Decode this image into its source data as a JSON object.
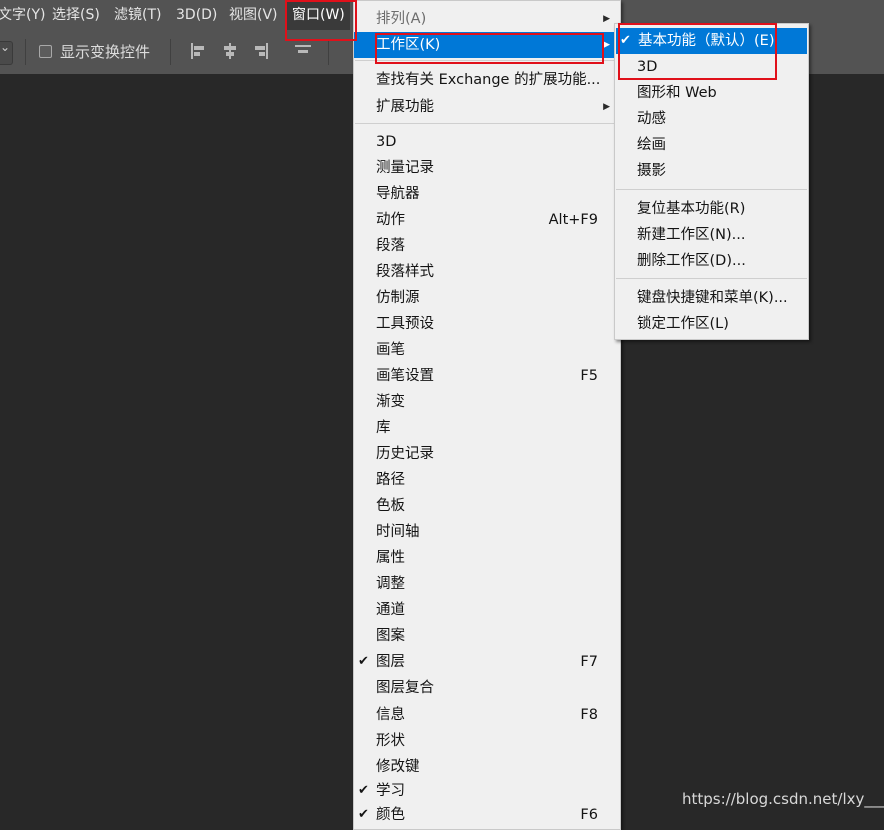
{
  "menubar": {
    "items": [
      {
        "label": "文字(Y)"
      },
      {
        "label": "选择(S)"
      },
      {
        "label": "滤镜(T)"
      },
      {
        "label": "3D(D)"
      },
      {
        "label": "视图(V)"
      },
      {
        "label": "窗口(W)"
      }
    ]
  },
  "options_bar": {
    "show_transform_label": "显示变换控件"
  },
  "window_menu": {
    "items": [
      {
        "label": "排列(A)",
        "shortcut": "",
        "submenu": true,
        "checked": false
      },
      {
        "label": "工作区(K)",
        "shortcut": "",
        "submenu": true,
        "checked": false
      },
      {
        "label": "查找有关 Exchange 的扩展功能...",
        "shortcut": "",
        "submenu": false,
        "checked": false
      },
      {
        "label": "扩展功能",
        "shortcut": "",
        "submenu": true,
        "checked": false
      },
      {
        "label": "3D",
        "shortcut": "",
        "submenu": false,
        "checked": false
      },
      {
        "label": "测量记录",
        "shortcut": "",
        "submenu": false,
        "checked": false
      },
      {
        "label": "导航器",
        "shortcut": "",
        "submenu": false,
        "checked": false
      },
      {
        "label": "动作",
        "shortcut": "Alt+F9",
        "submenu": false,
        "checked": false
      },
      {
        "label": "段落",
        "shortcut": "",
        "submenu": false,
        "checked": false
      },
      {
        "label": "段落样式",
        "shortcut": "",
        "submenu": false,
        "checked": false
      },
      {
        "label": "仿制源",
        "shortcut": "",
        "submenu": false,
        "checked": false
      },
      {
        "label": "工具预设",
        "shortcut": "",
        "submenu": false,
        "checked": false
      },
      {
        "label": "画笔",
        "shortcut": "",
        "submenu": false,
        "checked": false
      },
      {
        "label": "画笔设置",
        "shortcut": "F5",
        "submenu": false,
        "checked": false
      },
      {
        "label": "渐变",
        "shortcut": "",
        "submenu": false,
        "checked": false
      },
      {
        "label": "库",
        "shortcut": "",
        "submenu": false,
        "checked": false
      },
      {
        "label": "历史记录",
        "shortcut": "",
        "submenu": false,
        "checked": false
      },
      {
        "label": "路径",
        "shortcut": "",
        "submenu": false,
        "checked": false
      },
      {
        "label": "色板",
        "shortcut": "",
        "submenu": false,
        "checked": false
      },
      {
        "label": "时间轴",
        "shortcut": "",
        "submenu": false,
        "checked": false
      },
      {
        "label": "属性",
        "shortcut": "",
        "submenu": false,
        "checked": false
      },
      {
        "label": "调整",
        "shortcut": "",
        "submenu": false,
        "checked": false
      },
      {
        "label": "通道",
        "shortcut": "",
        "submenu": false,
        "checked": false
      },
      {
        "label": "图案",
        "shortcut": "",
        "submenu": false,
        "checked": false
      },
      {
        "label": "图层",
        "shortcut": "F7",
        "submenu": false,
        "checked": true
      },
      {
        "label": "图层复合",
        "shortcut": "",
        "submenu": false,
        "checked": false
      },
      {
        "label": "信息",
        "shortcut": "F8",
        "submenu": false,
        "checked": false
      },
      {
        "label": "形状",
        "shortcut": "",
        "submenu": false,
        "checked": false
      },
      {
        "label": "修改键",
        "shortcut": "",
        "submenu": false,
        "checked": false
      },
      {
        "label": "学习",
        "shortcut": "",
        "submenu": false,
        "checked": true
      },
      {
        "label": "颜色",
        "shortcut": "F6",
        "submenu": false,
        "checked": true
      }
    ]
  },
  "workspace_submenu": {
    "items": [
      {
        "label": "基本功能（默认）(E)",
        "checked": true
      },
      {
        "label": "3D",
        "checked": false
      },
      {
        "label": "图形和 Web",
        "checked": false
      },
      {
        "label": "动感",
        "checked": false
      },
      {
        "label": "绘画",
        "checked": false
      },
      {
        "label": "摄影",
        "checked": false
      },
      {
        "label": "复位基本功能(R)",
        "checked": false
      },
      {
        "label": "新建工作区(N)...",
        "checked": false
      },
      {
        "label": "删除工作区(D)...",
        "checked": false
      },
      {
        "label": "键盘快捷键和菜单(K)...",
        "checked": false
      },
      {
        "label": "锁定工作区(L)",
        "checked": false
      }
    ]
  },
  "watermark": "https://blog.csdn.net/lxy___",
  "colors": {
    "menubar_bg": "#535353",
    "canvas_bg": "#282828",
    "menu_bg": "#f0f0f0",
    "highlight": "#0078d7",
    "annotation_red": "#e0101a"
  }
}
